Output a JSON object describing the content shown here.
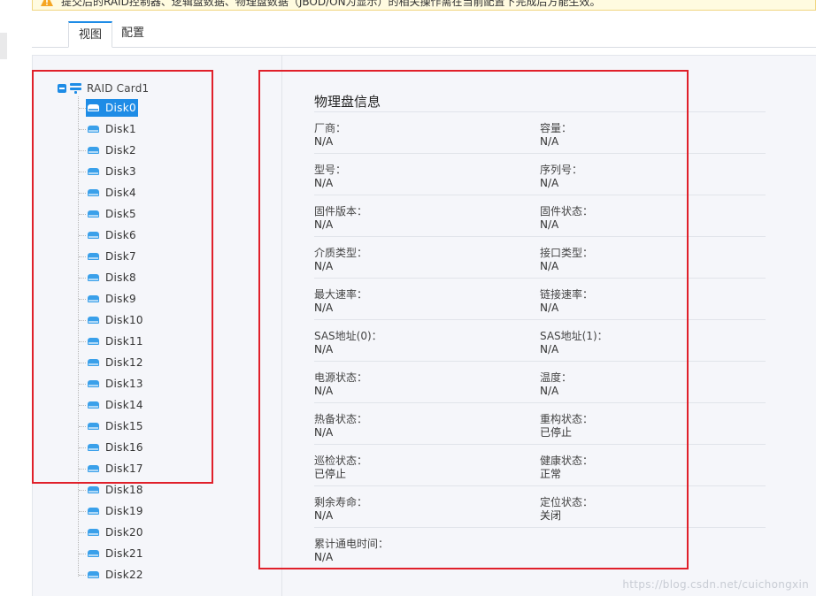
{
  "notice": {
    "text": "提交后的RAID控制器、逻辑盘数据、物理盘数据（JBOD/ON为显示）的相关操作需在当前配置下完成后方能生效。"
  },
  "tabs": [
    {
      "label": "视图",
      "active": true
    },
    {
      "label": "配置",
      "active": false
    }
  ],
  "tree": {
    "root_label": "RAID Card1",
    "selected_index": 0,
    "disks": [
      "Disk0",
      "Disk1",
      "Disk2",
      "Disk3",
      "Disk4",
      "Disk5",
      "Disk6",
      "Disk7",
      "Disk8",
      "Disk9",
      "Disk10",
      "Disk11",
      "Disk12",
      "Disk13",
      "Disk14",
      "Disk15",
      "Disk16",
      "Disk17",
      "Disk18",
      "Disk19",
      "Disk20",
      "Disk21",
      "Disk22"
    ]
  },
  "info": {
    "title": "物理盘信息",
    "rows": [
      [
        {
          "label": "厂商：",
          "value": "N/A"
        },
        {
          "label": "容量：",
          "value": "N/A"
        }
      ],
      [
        {
          "label": "型号：",
          "value": "N/A"
        },
        {
          "label": "序列号：",
          "value": "N/A"
        }
      ],
      [
        {
          "label": "固件版本：",
          "value": "N/A"
        },
        {
          "label": "固件状态：",
          "value": "N/A"
        }
      ],
      [
        {
          "label": "介质类型：",
          "value": "N/A"
        },
        {
          "label": "接口类型：",
          "value": "N/A"
        }
      ],
      [
        {
          "label": "最大速率：",
          "value": "N/A"
        },
        {
          "label": "链接速率：",
          "value": "N/A"
        }
      ],
      [
        {
          "label": "SAS地址(0)：",
          "value": "N/A"
        },
        {
          "label": "SAS地址(1)：",
          "value": "N/A"
        }
      ],
      [
        {
          "label": "电源状态：",
          "value": "N/A"
        },
        {
          "label": "温度：",
          "value": "N/A"
        }
      ],
      [
        {
          "label": "热备状态：",
          "value": "N/A"
        },
        {
          "label": "重构状态：",
          "value": "已停止"
        }
      ],
      [
        {
          "label": "巡检状态：",
          "value": "已停止"
        },
        {
          "label": "健康状态：",
          "value": "正常"
        }
      ],
      [
        {
          "label": "剩余寿命：",
          "value": "N/A"
        },
        {
          "label": "定位状态：",
          "value": "关闭"
        }
      ],
      [
        {
          "label": "累计通电时间：",
          "value": "N/A"
        }
      ]
    ]
  },
  "watermark": "https://blog.csdn.net/cuichongxin",
  "colors": {
    "accent": "#1e8ce6",
    "annotation": "#e0202a",
    "panel_bg": "#f5f6fa"
  }
}
